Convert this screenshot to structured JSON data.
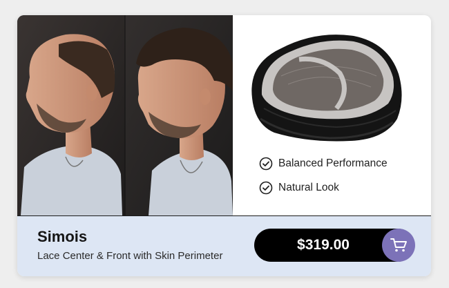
{
  "product": {
    "name": "Simois",
    "description": "Lace Center & Front with Skin Perimeter",
    "price": "$319.00"
  },
  "features": [
    {
      "label": "Balanced Performance",
      "icon": "check-circle-icon"
    },
    {
      "label": "Natural Look",
      "icon": "check-circle-icon"
    }
  ],
  "images": {
    "before_after": "before-after-photo",
    "product": "hair-system-photo"
  },
  "colors": {
    "background": "#eeeeee",
    "bottom_bar": "#dde6f4",
    "price_button": "#000000",
    "cart_button": "#7c72b8"
  },
  "icons": {
    "cart": "shopping-cart-icon"
  }
}
